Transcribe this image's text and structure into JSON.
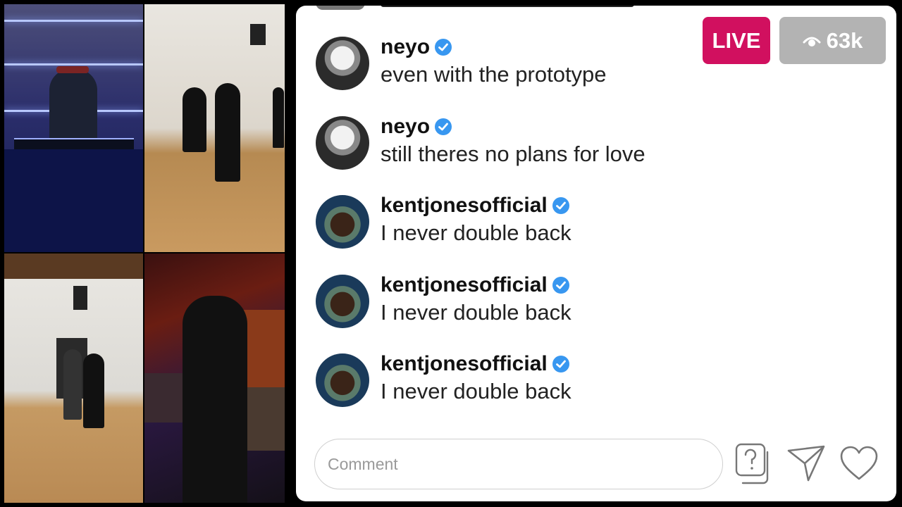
{
  "stream": {
    "live_label": "LIVE",
    "viewer_count": "63k"
  },
  "comments": [
    {
      "username": "neyo",
      "verified": true,
      "text": "even with the prototype"
    },
    {
      "username": "neyo",
      "verified": true,
      "text": "still theres no plans for love"
    },
    {
      "username": "kentjonesofficial",
      "verified": true,
      "text": "I never double back"
    },
    {
      "username": "kentjonesofficial",
      "verified": true,
      "text": "I never double back"
    },
    {
      "username": "kentjonesofficial",
      "verified": true,
      "text": "I never double back"
    }
  ],
  "composer": {
    "placeholder": "Comment"
  },
  "icons": {
    "viewers": "eye-icon",
    "verified": "verified-badge-icon",
    "qa": "question-box-icon",
    "send": "paper-plane-icon",
    "like": "heart-icon"
  },
  "colors": {
    "live": "#d1105f",
    "viewers_badge": "#b3b3b3",
    "verified": "#3897f0"
  }
}
